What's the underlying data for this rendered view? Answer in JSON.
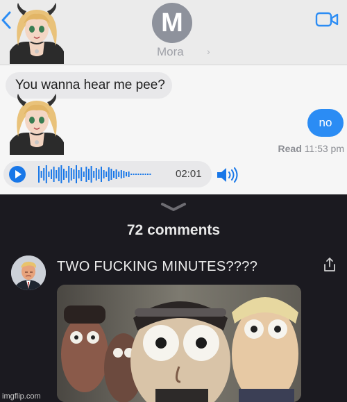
{
  "conversation": {
    "contact_initial": "M",
    "contact_name": "Mora",
    "name_chevron": "›",
    "messages": {
      "incoming_text": "You wanna hear me pee?",
      "outgoing_text": "no",
      "read_label": "Read",
      "read_time": "11:53 pm"
    },
    "audio": {
      "duration": "02:01"
    }
  },
  "comments": {
    "count_label": "72 comments",
    "items": [
      {
        "text": "TWO FUCKING MINUTES????"
      }
    ]
  },
  "watermark": "imgflip.com",
  "colors": {
    "imessage_blue": "#2b8cf4",
    "audio_blue": "#1877e8",
    "incoming_bubble": "#e8e8ea",
    "dark_panel": "#1b1a20"
  },
  "icons": {
    "back": "chevron-left-icon",
    "video": "video-call-icon",
    "play": "play-icon",
    "speaker": "speaker-icon",
    "handle": "chevron-down-icon",
    "share": "share-icon"
  }
}
